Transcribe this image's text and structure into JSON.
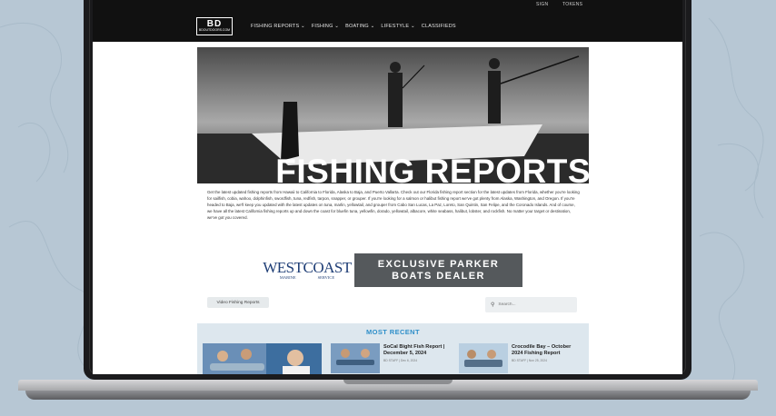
{
  "nav": {
    "top_links": [
      "SIGN",
      "TOKENS"
    ],
    "logo": {
      "main": "BD",
      "sub": "BDOUTDOORS.COM"
    },
    "menu": [
      "FISHING REPORTS ⌄",
      "FISHING ⌄",
      "BOATING ⌄",
      "LIFESTYLE ⌄",
      "CLASSIFIEDS"
    ]
  },
  "hero": {
    "title": "FISHING REPORTS"
  },
  "intro": "Get the latest updated fishing reports from Hawaii to California to Florida, Alaska to Baja, and Puerto Vallarta. Check out our Florida fishing report section for the latest updates from Florida, whether you're looking for sailfish, cobia, wahoo, dolphinfish, swordfish, tuna, redfish, tarpon, snapper, or grouper. If you're looking for a salmon or halibut fishing report we've got plenty from Alaska, Washington, and Oregon. If you're headed to Baja, we'll keep you updated with the latest updates on tuna, marlin, yellowtail, and grouper from Cabo San Lucas, La Paz, Loreto, San Quintin, San Felipe, and the Coronado Islands. And of course, we have all the latest California fishing reports up and down the coast for bluefin tuna, yellowfin, dorado, yellowtail, albacore, white seabass, halibut, lobster, and rockfish. No matter your target or destination, we've got you covered.",
  "ads": {
    "westcoast": {
      "main": "WESTCOAST",
      "left": "MARINE",
      "right": "SERVICE"
    },
    "parker": {
      "line1": "EXCLUSIVE PARKER",
      "line2": "BOATS DEALER"
    }
  },
  "video_button": "Video Fishing Reports",
  "search": {
    "placeholder": "Search..."
  },
  "recent": {
    "heading": "MOST RECENT",
    "posts": [
      {
        "title_line1": "SoCal Bight Fish Report |",
        "title_line2": "December 5, 2024",
        "meta": "BD STAFF | Dec 6, 2024"
      },
      {
        "title_line1": "Crocodile Bay – October",
        "title_line2": "2024 Fishing Report",
        "meta": "BD STAFF | Nov 25, 2024"
      }
    ]
  },
  "colors": {
    "accent": "#2f8fc9",
    "nav_bg": "#111111",
    "recent_bg": "#dde7ee"
  }
}
